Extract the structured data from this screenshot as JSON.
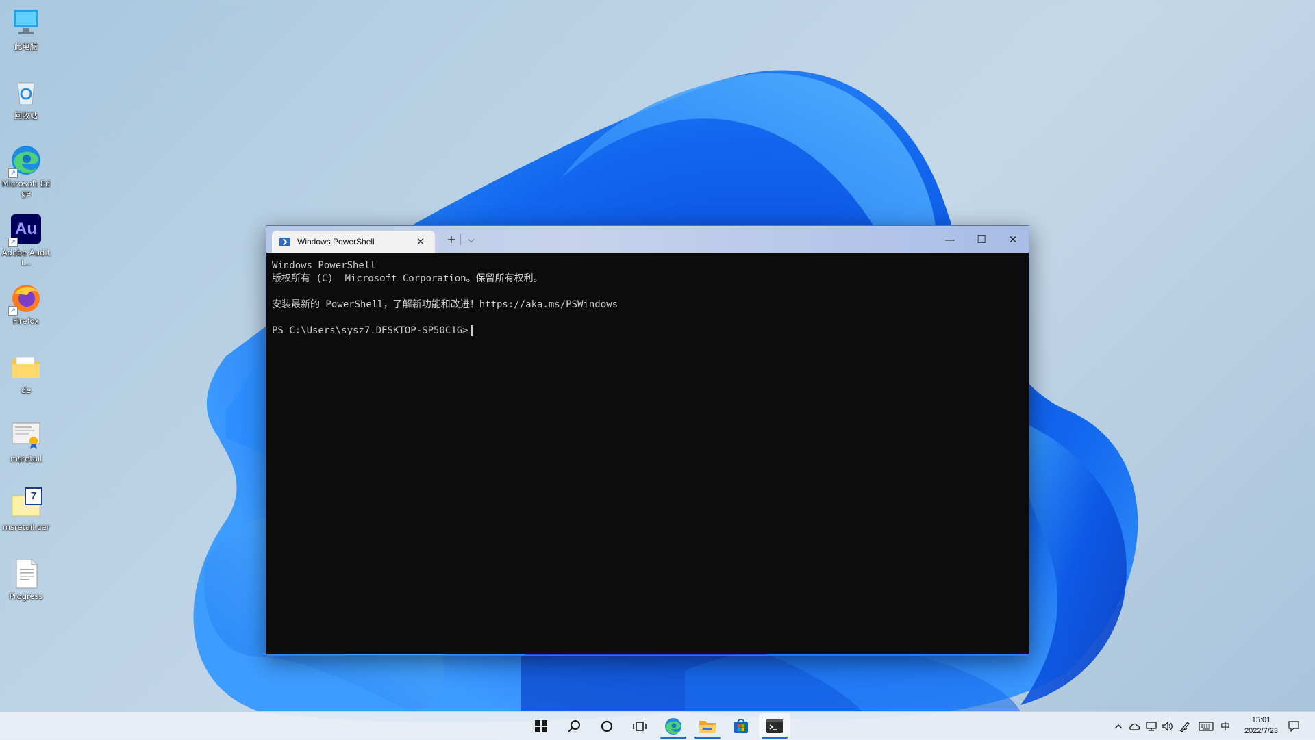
{
  "desktop": {
    "icons": [
      {
        "label": "此电脑",
        "icon": "computer-icon"
      },
      {
        "label": "回收站",
        "icon": "recycle-bin-icon"
      },
      {
        "label": "Microsoft Edge",
        "icon": "edge-icon"
      },
      {
        "label": "Adobe Auditi...",
        "icon": "audition-icon",
        "glyph_text": "Au"
      },
      {
        "label": "Firefox",
        "icon": "firefox-icon"
      },
      {
        "label": "de",
        "icon": "folder-icon"
      },
      {
        "label": "msretail",
        "icon": "certificate-icon"
      },
      {
        "label": "msretail.cer",
        "icon": "cer-file-icon",
        "glyph_text": "7"
      },
      {
        "label": "Progress",
        "icon": "text-file-icon"
      }
    ]
  },
  "terminal": {
    "tab_title": "Windows PowerShell",
    "new_tab_symbol": "+",
    "dropdown_symbol": "⌵",
    "close_tab_symbol": "✕",
    "window_controls": {
      "minimize": "—",
      "maximize": "☐",
      "close": "✕"
    },
    "lines": [
      "Windows PowerShell",
      "版权所有 (C)  Microsoft Corporation。保留所有权利。",
      "",
      "安装最新的 PowerShell，了解新功能和改进！https://aka.ms/PSWindows",
      "",
      "PS C:\\Users\\sysz7.DESKTOP-SP50C1G>"
    ],
    "background": "#0c0c0c",
    "text_color": "#cccccc"
  },
  "taskbar": {
    "apps": [
      {
        "name": "start",
        "icon": "windows-start-icon"
      },
      {
        "name": "search",
        "icon": "search-icon"
      },
      {
        "name": "cortana",
        "icon": "cortana-circle-icon"
      },
      {
        "name": "task-view",
        "icon": "task-view-icon"
      },
      {
        "name": "edge",
        "icon": "edge-icon",
        "running": true
      },
      {
        "name": "file-explorer",
        "icon": "folder-icon",
        "running": true
      },
      {
        "name": "store",
        "icon": "store-icon"
      },
      {
        "name": "terminal",
        "icon": "terminal-icon",
        "running": true,
        "active": true
      }
    ],
    "tray": {
      "chevron": "^",
      "ime": "中",
      "time": "15:01",
      "date": "2022/7/23"
    },
    "accent_color": "#1b6fd3"
  }
}
